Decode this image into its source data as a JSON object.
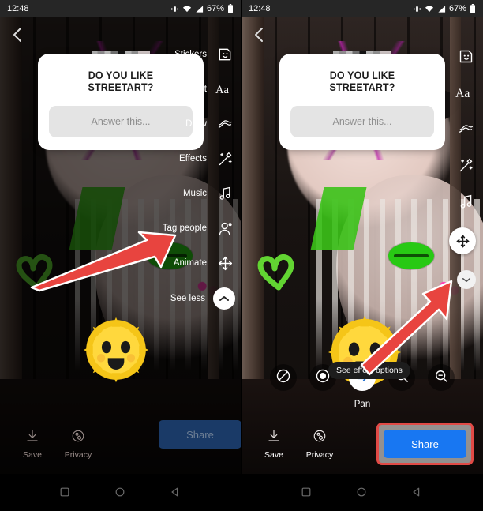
{
  "statusbar": {
    "time": "12:48",
    "battery": "67%",
    "icons": [
      "vibrate-icon",
      "wifi-icon",
      "signal-icon",
      "battery-icon"
    ]
  },
  "sticker": {
    "question": "DO YOU LIKE STREETART?",
    "answer_placeholder": "Answer this..."
  },
  "left_panel": {
    "rail": [
      {
        "label": "Stickers",
        "icon": "sticker-face-icon"
      },
      {
        "label": "Text",
        "icon": "text-aa-icon"
      },
      {
        "label": "Draw",
        "icon": "draw-squiggle-icon"
      },
      {
        "label": "Effects",
        "icon": "effects-wand-icon"
      },
      {
        "label": "Music",
        "icon": "music-note-icon"
      },
      {
        "label": "Tag people",
        "icon": "tag-person-icon"
      },
      {
        "label": "Animate",
        "icon": "animate-move-icon"
      },
      {
        "label": "See less",
        "icon": "chevron-up-icon"
      }
    ],
    "bottom": {
      "save_label": "Save",
      "privacy_label": "Privacy",
      "share_label": "Share"
    },
    "annotation": {
      "type": "arrow",
      "points_to": "Animate"
    }
  },
  "right_panel": {
    "rail": [
      {
        "label": "",
        "icon": "sticker-face-icon"
      },
      {
        "label": "",
        "icon": "text-aa-icon"
      },
      {
        "label": "",
        "icon": "draw-squiggle-icon"
      },
      {
        "label": "",
        "icon": "effects-wand-icon"
      },
      {
        "label": "",
        "icon": "music-note-icon"
      },
      {
        "label": "",
        "icon": "animate-move-icon"
      },
      {
        "label": "",
        "icon": "chevron-down-icon"
      }
    ],
    "tooltip": "See effect options",
    "effects": {
      "selected": "Pan",
      "selected_label": "Pan",
      "options": [
        {
          "name": "none",
          "icon": "no-effect-slash-icon",
          "active": false
        },
        {
          "name": "pulse",
          "icon": "pulse-dot-icon",
          "active": false
        },
        {
          "name": "pan",
          "icon": "pan-arrows-icon",
          "active": true
        },
        {
          "name": "zoom-in",
          "icon": "magnifier-plus-icon",
          "active": false
        },
        {
          "name": "zoom-out",
          "icon": "magnifier-minus-icon",
          "active": false
        }
      ]
    },
    "bottom": {
      "save_label": "Save",
      "privacy_label": "Privacy",
      "share_label": "Share"
    },
    "annotation": {
      "type": "arrow",
      "points_to": "Pan",
      "highlight": "Share button"
    }
  },
  "navbar": {
    "recents": "recents-square-icon",
    "home": "home-circle-icon",
    "back": "back-triangle-icon"
  },
  "colors": {
    "share_blue": "#1877f2",
    "share_blue_dim": "#1a3a67",
    "annotation_red": "#e04a46",
    "sticker_white": "#ffffff",
    "statusbar_bg": "#262626"
  }
}
